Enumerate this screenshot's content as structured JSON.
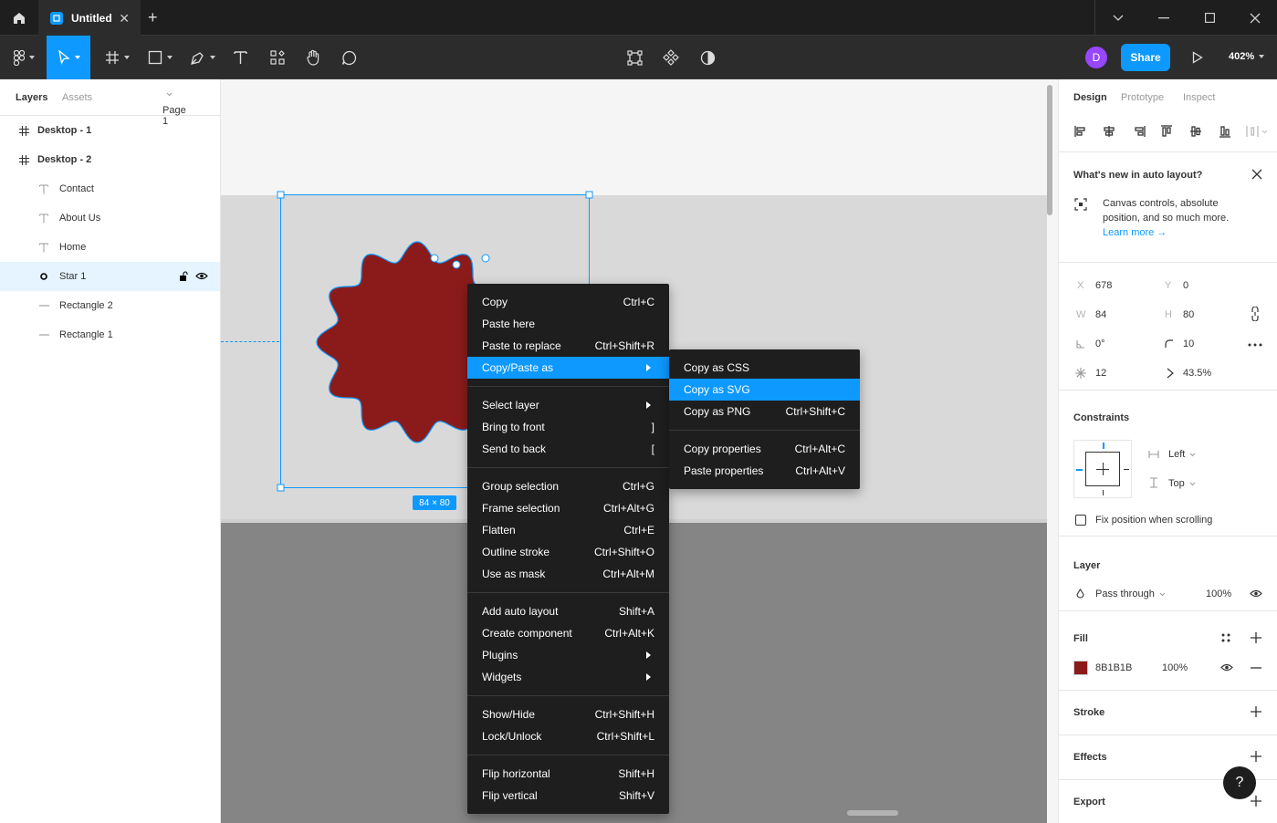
{
  "titlebar": {
    "tab_title": "Untitled"
  },
  "toolbar": {
    "avatar_initial": "D",
    "share_label": "Share",
    "zoom": "402%"
  },
  "layers_panel": {
    "tabs": [
      "Layers",
      "Assets"
    ],
    "page": "Page 1",
    "layers": [
      {
        "name": "Desktop - 1",
        "icon": "frame-icon",
        "indent": 0,
        "selected": false
      },
      {
        "name": "Desktop - 2",
        "icon": "frame-icon",
        "indent": 0,
        "selected": false
      },
      {
        "name": "Contact",
        "icon": "text-icon",
        "indent": 1,
        "selected": false
      },
      {
        "name": "About Us",
        "icon": "text-icon",
        "indent": 1,
        "selected": false
      },
      {
        "name": "Home",
        "icon": "text-icon",
        "indent": 1,
        "selected": false
      },
      {
        "name": "Star 1",
        "icon": "star-icon",
        "indent": 1,
        "selected": true
      },
      {
        "name": "Rectangle 2",
        "icon": "line-icon",
        "indent": 1,
        "selected": false
      },
      {
        "name": "Rectangle 1",
        "icon": "line-icon",
        "indent": 1,
        "selected": false
      }
    ]
  },
  "canvas": {
    "size_badge": "84 × 80",
    "star_color": "#8B1B1B"
  },
  "context_menu": {
    "groups": [
      [
        {
          "label": "Copy",
          "shortcut": "Ctrl+C"
        },
        {
          "label": "Paste here",
          "shortcut": ""
        },
        {
          "label": "Paste to replace",
          "shortcut": "Ctrl+Shift+R"
        },
        {
          "label": "Copy/Paste as",
          "shortcut": "",
          "submenu": true,
          "highlighted": true
        }
      ],
      [
        {
          "label": "Select layer",
          "shortcut": "",
          "submenu": true
        },
        {
          "label": "Bring to front",
          "shortcut": "]"
        },
        {
          "label": "Send to back",
          "shortcut": "["
        }
      ],
      [
        {
          "label": "Group selection",
          "shortcut": "Ctrl+G"
        },
        {
          "label": "Frame selection",
          "shortcut": "Ctrl+Alt+G"
        },
        {
          "label": "Flatten",
          "shortcut": "Ctrl+E"
        },
        {
          "label": "Outline stroke",
          "shortcut": "Ctrl+Shift+O"
        },
        {
          "label": "Use as mask",
          "shortcut": "Ctrl+Alt+M"
        }
      ],
      [
        {
          "label": "Add auto layout",
          "shortcut": "Shift+A"
        },
        {
          "label": "Create component",
          "shortcut": "Ctrl+Alt+K"
        },
        {
          "label": "Plugins",
          "shortcut": "",
          "submenu": true
        },
        {
          "label": "Widgets",
          "shortcut": "",
          "submenu": true
        }
      ],
      [
        {
          "label": "Show/Hide",
          "shortcut": "Ctrl+Shift+H"
        },
        {
          "label": "Lock/Unlock",
          "shortcut": "Ctrl+Shift+L"
        }
      ],
      [
        {
          "label": "Flip horizontal",
          "shortcut": "Shift+H"
        },
        {
          "label": "Flip vertical",
          "shortcut": "Shift+V"
        }
      ]
    ]
  },
  "submenu": {
    "groups": [
      [
        {
          "label": "Copy as CSS",
          "shortcut": ""
        },
        {
          "label": "Copy as SVG",
          "shortcut": "",
          "highlighted": true
        },
        {
          "label": "Copy as PNG",
          "shortcut": "Ctrl+Shift+C"
        }
      ],
      [
        {
          "label": "Copy properties",
          "shortcut": "Ctrl+Alt+C"
        },
        {
          "label": "Paste properties",
          "shortcut": "Ctrl+Alt+V"
        }
      ]
    ]
  },
  "design_panel": {
    "tabs": [
      "Design",
      "Prototype",
      "Inspect"
    ],
    "whats_new": {
      "title": "What's new in auto layout?",
      "body_line1": "Canvas controls, absolute",
      "body_line2": "position, and so much more.",
      "link": "Learn more →"
    },
    "props": {
      "x_label": "X",
      "x": "678",
      "y_label": "Y",
      "y": "0",
      "w_label": "W",
      "w": "84",
      "h_label": "H",
      "h": "80",
      "rotation": "0°",
      "radius": "10",
      "points": "12",
      "ratio": "43.5%"
    },
    "constraints": {
      "title": "Constraints",
      "horizontal": "Left",
      "vertical": "Top",
      "fix_label": "Fix position when scrolling"
    },
    "layer": {
      "title": "Layer",
      "blend": "Pass through",
      "opacity": "100%"
    },
    "fill": {
      "title": "Fill",
      "hex": "8B1B1B",
      "opacity": "100%",
      "color": "#8B1B1B"
    },
    "stroke_title": "Stroke",
    "effects_title": "Effects",
    "export_title": "Export",
    "help": "?"
  }
}
